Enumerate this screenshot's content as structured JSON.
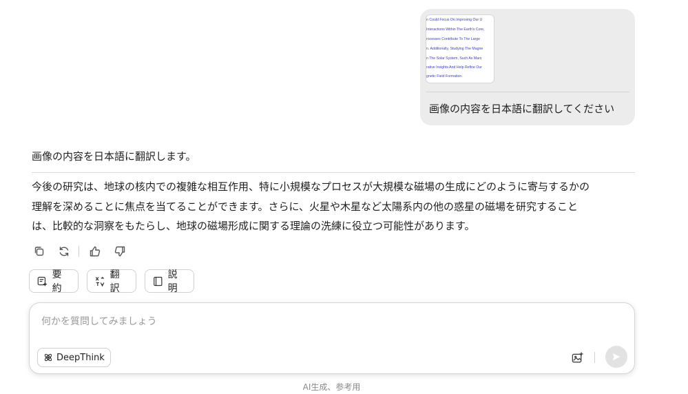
{
  "user_message": {
    "thumbnail_lines": [
      "n Could Focus On Improving Our U",
      "Interactions Within The Earth's Core,",
      "rocesses Contribute To The Large",
      "n. Additionally, Studying The Magne",
      "n The Solar System, Such As Mars",
      "rative Insights And Help Refine Our",
      "gnetic Field Formation."
    ],
    "text": "画像の内容を日本語に翻訳してください"
  },
  "assistant_message": {
    "heading": "画像の内容を日本語に翻訳します。",
    "body_lines": [
      "今後の研究は、地球の核内での複雑な相互作用、特に小規模なプロセスが大規模な磁場の生成にどのように寄与するかの",
      "理解を深めることに焦点を当てることができます。さらに、火星や木星など太陽系内の他の惑星の磁場を研究すること",
      "は、比較的な洞察をもたらし、地球の磁場形成に関する理論の洗練に役立つ可能性があります。"
    ]
  },
  "actions": {
    "icons": [
      "copy-icon",
      "regenerate-icon",
      "thumbs-up-icon",
      "thumbs-down-icon"
    ]
  },
  "quick_chips": {
    "summarize": "要約",
    "translate": "翻訳",
    "explain": "説明"
  },
  "input": {
    "placeholder": "何かを質問してみましょう",
    "deepthink_label": "DeepThink"
  },
  "footer": "AI生成、参考用"
}
